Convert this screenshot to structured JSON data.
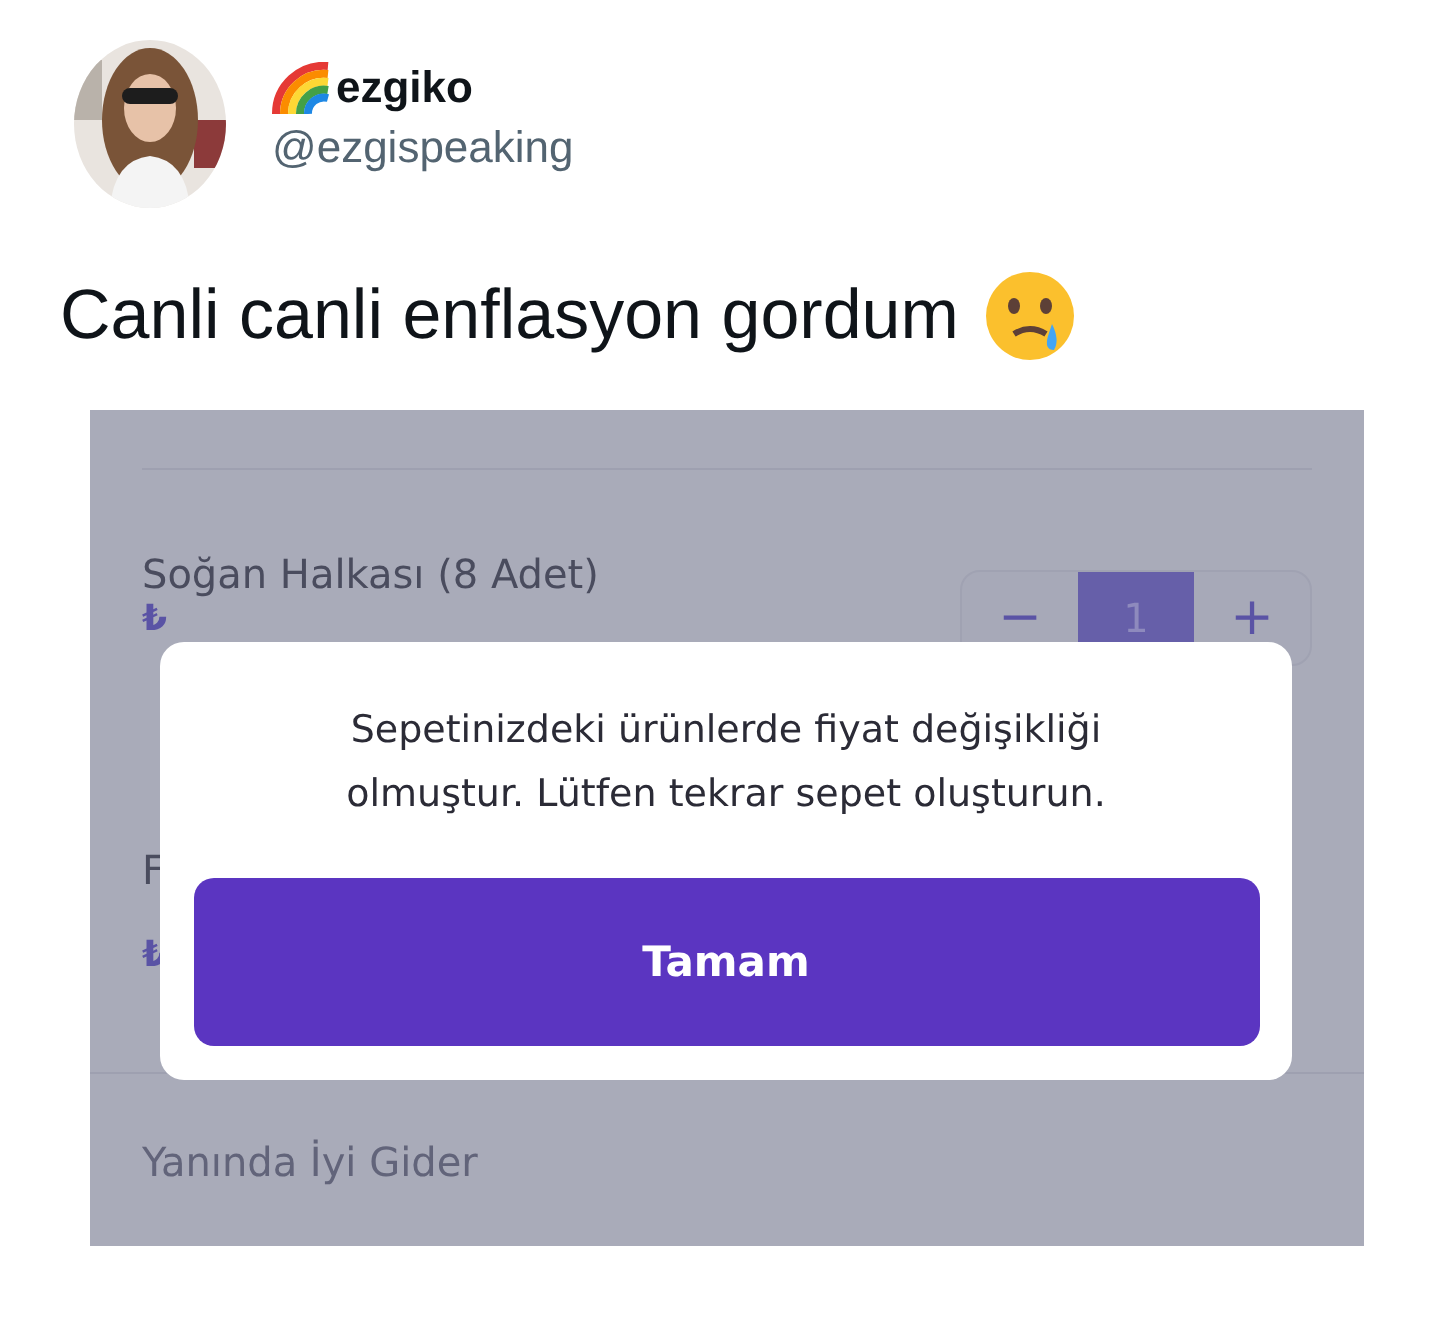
{
  "author": {
    "name": "ezgiko",
    "handle": "@ezgispeaking"
  },
  "tweet": {
    "text": "Canli canli enflasyon gordum"
  },
  "app_screenshot": {
    "item": {
      "name": "Soğan Halkası (8 Adet)",
      "price_mark": "₺",
      "stepper": {
        "minus": "−",
        "quantity": "1",
        "plus": "+"
      }
    },
    "partial_item": {
      "name": "F",
      "price_mark": "₺"
    },
    "section": "Yanında İyi Gider",
    "dialog": {
      "message": "Sepetinizdeki ürünlerde fiyat değişikliği olmuştur. Lütfen tekrar sepet oluşturun.",
      "button": "Tamam"
    }
  }
}
